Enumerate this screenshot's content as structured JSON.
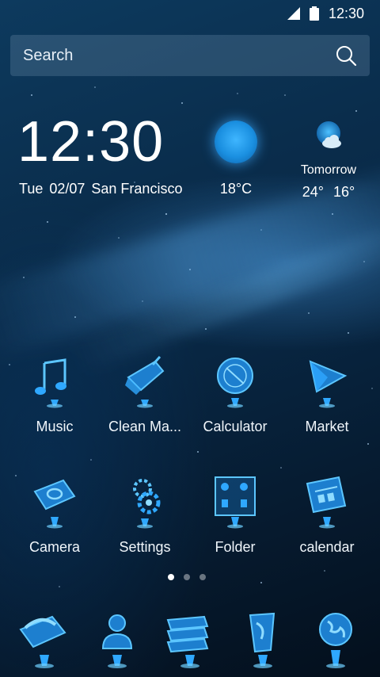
{
  "status_bar": {
    "time": "12:30"
  },
  "search": {
    "placeholder": "Search"
  },
  "clock_widget": {
    "time": "12:30",
    "day": "Tue",
    "date": "02/07",
    "city": "San Francisco",
    "current_temp": "18°C",
    "tomorrow_label": "Tomorrow",
    "tomorrow_high": "24°",
    "tomorrow_low": "16°"
  },
  "apps": [
    {
      "label": "Music",
      "icon": "music-note-icon"
    },
    {
      "label": "Clean Ma...",
      "icon": "broom-icon"
    },
    {
      "label": "Calculator",
      "icon": "calculator-icon"
    },
    {
      "label": "Market",
      "icon": "play-store-icon"
    },
    {
      "label": "Camera",
      "icon": "camera-icon"
    },
    {
      "label": "Settings",
      "icon": "gear-icon"
    },
    {
      "label": "Folder",
      "icon": "folder-icon"
    },
    {
      "label": "calendar",
      "icon": "calendar-icon"
    }
  ],
  "page_indicator": {
    "count": 3,
    "active_index": 0
  },
  "dock": [
    {
      "icon": "phone-icon"
    },
    {
      "icon": "contacts-icon"
    },
    {
      "icon": "messages-icon"
    },
    {
      "icon": "browser-icon"
    },
    {
      "icon": "globe-icon"
    }
  ],
  "colors": {
    "accent": "#2fa8ff",
    "glow": "#5cc6ff",
    "background": "#082744"
  }
}
